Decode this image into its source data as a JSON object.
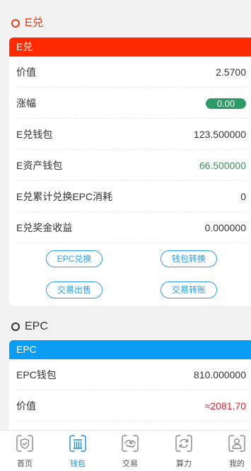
{
  "colors": {
    "e_accent": "#ee3a12",
    "e_header": "#ff2a00",
    "epc_ring": "#333333",
    "epc_header": "#0b9cf4",
    "button": "#2a9bf2",
    "positive_pill": "#2c9b66",
    "positive_text": "#3a8f5c",
    "negative_text": "#e1202c",
    "nav_active": "#1d8be0",
    "nav_inactive": "#555555"
  },
  "e_section": {
    "title": "E兑",
    "icon": "circle-icon",
    "card_header": "E兑",
    "rows": {
      "price": {
        "label": "价值",
        "value": "2.5700"
      },
      "change": {
        "label": "涨幅",
        "value": "0.00"
      },
      "wallet": {
        "label": "E兑钱包",
        "value": "123.500000"
      },
      "asset_wallet": {
        "label": "E资产钱包",
        "value": "66.500000"
      },
      "epc_consumed": {
        "label": "E兑累计兑换EPC消耗",
        "value": "0"
      },
      "bonus": {
        "label": "E兑奖金收益",
        "value": "0.000000"
      }
    },
    "buttons": {
      "epc_exchange": "EPC兑换",
      "wallet_transfer": "钱包转换",
      "trade_sell": "交易出售",
      "trade_transfer": "交易转账"
    }
  },
  "epc_section": {
    "title": "EPC",
    "icon": "circle-icon",
    "card_header": "EPC",
    "rows": {
      "wallet": {
        "label": "EPC钱包",
        "value": "810.000000"
      },
      "price": {
        "label": "价值",
        "value": "≈2081.70"
      }
    }
  },
  "bottom_nav": {
    "items": [
      {
        "label": "首页",
        "icon": "home-icon",
        "active": false
      },
      {
        "label": "钱包",
        "icon": "wallet-icon",
        "active": true
      },
      {
        "label": "交易",
        "icon": "trade-icon",
        "active": false
      },
      {
        "label": "算力",
        "icon": "computing-power-icon",
        "active": false
      },
      {
        "label": "我的",
        "icon": "profile-icon",
        "active": false
      }
    ]
  }
}
